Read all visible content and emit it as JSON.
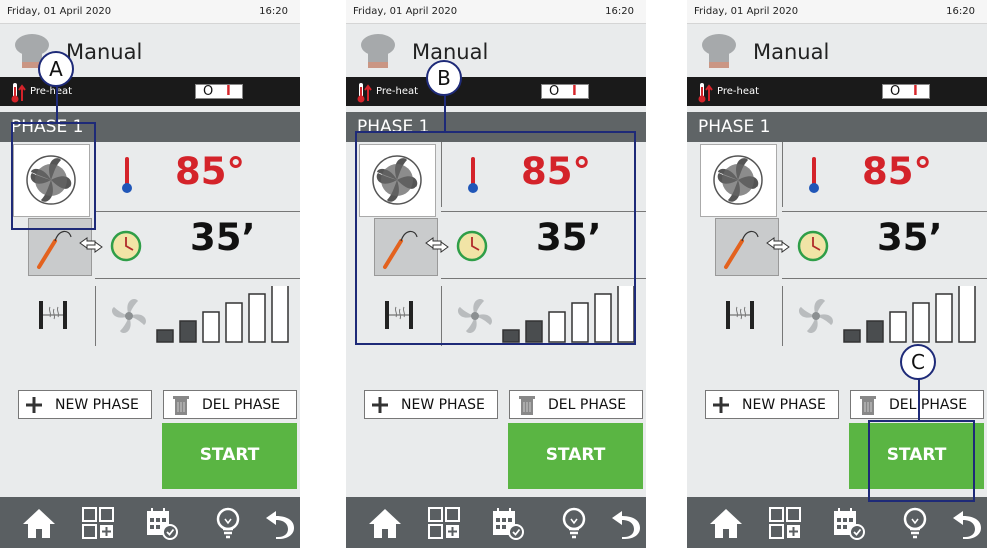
{
  "screens": [
    {
      "date": "Friday, 01 April 2020",
      "time": "16:20",
      "program": "Manual",
      "preheat_label": "Pre-heat",
      "toggle_off": "O",
      "toggle_on": "I",
      "phase": "PHASE 1",
      "temperature": "85°",
      "duration": "35’",
      "new_phase": "NEW PHASE",
      "del_phase": "DEL PHASE",
      "start": "START",
      "marker": "A"
    },
    {
      "date": "Friday, 01 April 2020",
      "time": "16:20",
      "program": "Manual",
      "preheat_label": "Pre-heat",
      "toggle_off": "O",
      "toggle_on": "I",
      "phase": "PHASE 1",
      "temperature": "85°",
      "duration": "35’",
      "new_phase": "NEW PHASE",
      "del_phase": "DEL PHASE",
      "start": "START",
      "marker": "B"
    },
    {
      "date": "Friday, 01 April 2020",
      "time": "16:20",
      "program": "Manual",
      "preheat_label": "Pre-heat",
      "toggle_off": "O",
      "toggle_on": "I",
      "phase": "PHASE 1",
      "temperature": "85°",
      "duration": "35’",
      "new_phase": "NEW PHASE",
      "del_phase": "DEL PHASE",
      "start": "START",
      "marker": "C"
    }
  ],
  "fan_speed_level": 2,
  "fan_speed_max": 6,
  "icons": {
    "program": "chef-hat-icon",
    "preheat": "thermometer-up-icon",
    "cooking_mode": "steam-convection-icon",
    "temperature": "thermometer-icon",
    "probe": "core-probe-icon",
    "swap": "swap-arrows-icon",
    "timer": "clock-icon",
    "humidity": "humidity-valve-icon",
    "fan": "fan-icon",
    "add": "plus-icon",
    "delete": "trash-icon",
    "home": "home-icon",
    "programs": "programs-grid-icon",
    "calendar": "calendar-icon",
    "tips": "lightbulb-icon",
    "back": "back-arrow-icon"
  },
  "colors": {
    "start": "#5ab543",
    "temperature": "#d4232a",
    "callout": "#1e2a78",
    "header": "#5f6466",
    "bottombar": "#5a5f62"
  }
}
